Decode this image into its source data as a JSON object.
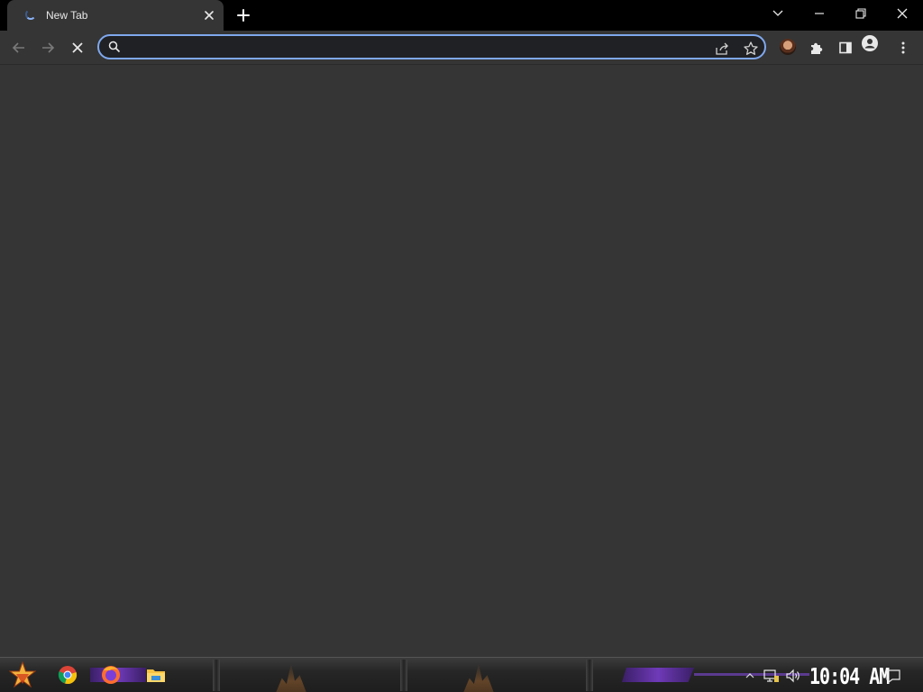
{
  "browser": {
    "tab": {
      "title": "New Tab",
      "loading": true
    },
    "omnibox": {
      "value": "",
      "placeholder": ""
    },
    "colors": {
      "frame": "#000000",
      "toolbar": "#353535",
      "omnibox_focus_ring": "#7fa8ee",
      "page_background": "#353535"
    }
  },
  "icons": {
    "tab_close": "close-icon",
    "new_tab": "plus-icon",
    "tab_search": "chevron-down-icon",
    "minimize": "minimize-icon",
    "restore": "restore-icon",
    "close_window": "close-icon",
    "back": "arrow-left-icon",
    "forward": "arrow-right-icon",
    "stop": "stop-icon",
    "search": "search-icon",
    "share": "share-icon",
    "bookmark": "star-icon",
    "extensions": "puzzle-icon",
    "side_panel": "side-panel-icon",
    "profile": "profile-icon",
    "menu": "kebab-menu-icon"
  },
  "taskbar": {
    "clock": "10:04 AM",
    "pinned_apps": [
      "chrome-icon",
      "firefox-icon",
      "file-explorer-icon"
    ],
    "tray": [
      "chevron-up-icon",
      "network-icon",
      "volume-icon",
      "notifications-icon"
    ]
  }
}
